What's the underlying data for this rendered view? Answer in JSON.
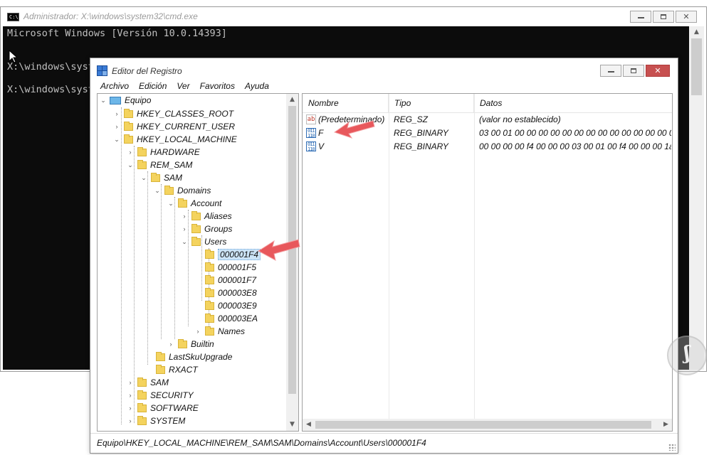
{
  "cmd": {
    "title": "Administrador: X:\\windows\\system32\\cmd.exe",
    "lines": [
      "Microsoft Windows [Versión 10.0.14393]",
      "X:\\windows\\syst",
      "X:\\windows\\syst"
    ]
  },
  "regedit": {
    "title": "Editor del Registro",
    "menu": [
      "Archivo",
      "Edición",
      "Ver",
      "Favoritos",
      "Ayuda"
    ],
    "tree": {
      "root": "Equipo",
      "hkcr": "HKEY_CLASSES_ROOT",
      "hkcu": "HKEY_CURRENT_USER",
      "hklm": "HKEY_LOCAL_MACHINE",
      "hardware": "HARDWARE",
      "rem_sam": "REM_SAM",
      "sam": "SAM",
      "domains": "Domains",
      "account": "Account",
      "aliases": "Aliases",
      "groups": "Groups",
      "users": "Users",
      "u1": "000001F4",
      "u2": "000001F5",
      "u3": "000001F7",
      "u4": "000003E8",
      "u5": "000003E9",
      "u6": "000003EA",
      "names": "Names",
      "builtin": "Builtin",
      "lastsku": "LastSkuUpgrade",
      "rxact": "RXACT",
      "sam2": "SAM",
      "security": "SECURITY",
      "software": "SOFTWARE",
      "system": "SYSTEM"
    },
    "columns": {
      "name": "Nombre",
      "type": "Tipo",
      "data": "Datos"
    },
    "values": [
      {
        "icon": "string-value-icon",
        "name": "(Predeterminado)",
        "type": "REG_SZ",
        "data": "(valor no establecido)"
      },
      {
        "icon": "binary-value-icon",
        "name": "F",
        "type": "REG_BINARY",
        "data": "03 00 01 00 00 00 00 00 00 00 00 00 00 00 00 00 00 0..."
      },
      {
        "icon": "binary-value-icon",
        "name": "V",
        "type": "REG_BINARY",
        "data": "00 00 00 00 f4 00 00 00 03 00 01 00 f4 00 00 00 1a 00..."
      }
    ],
    "status_path": "Equipo\\HKEY_LOCAL_MACHINE\\REM_SAM\\SAM\\Domains\\Account\\Users\\000001F4"
  },
  "colors": {
    "accent_arrow": "#e8585c",
    "selection": "#cce4f7",
    "console_bg": "#0c0c0c"
  }
}
